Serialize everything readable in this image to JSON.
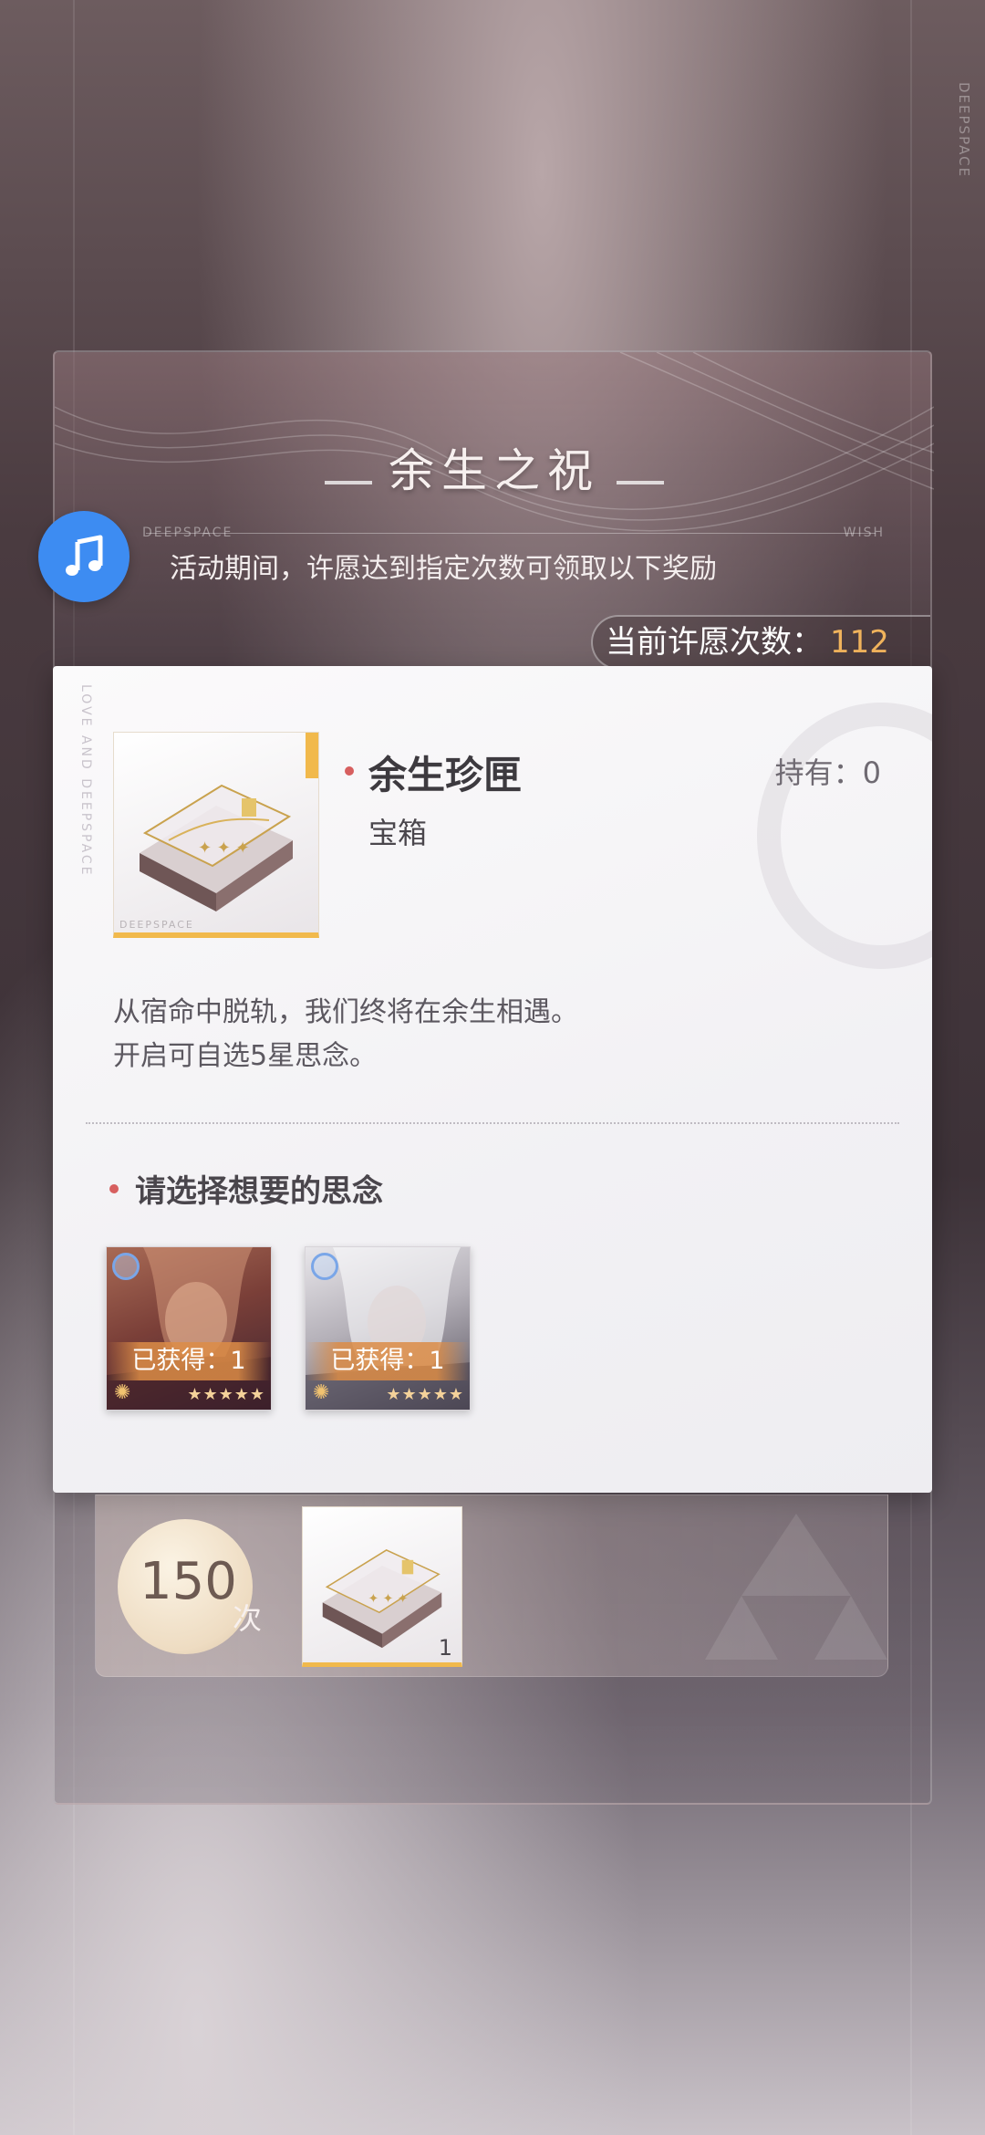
{
  "event": {
    "title": "余生之祝",
    "subtitle": "活动期间，许愿达到指定次数可领取以下奖励",
    "brand_left": "DEEPSPACE",
    "brand_right": "WISH",
    "side_text": "DEEPSPACE"
  },
  "wish_count": {
    "label": "当前许愿次数：",
    "value": "112"
  },
  "item": {
    "name": "余生珍匣",
    "type": "宝箱",
    "owned_label": "持有：0",
    "frame_brand": "DEEPSPACE",
    "card_vertical_text": "LOVE AND DEEPSPACE",
    "description": [
      "从宿命中脱轨，我们终将在余生相遇。",
      "开启可自选5星思念。"
    ]
  },
  "selection": {
    "title": "请选择想要的思念",
    "memories": [
      {
        "owned_label": "已获得：1",
        "stars": "★★★★★",
        "palette": "crimson"
      },
      {
        "owned_label": "已获得：1",
        "stars": "★★★★★",
        "palette": "silver"
      }
    ]
  },
  "milestone": {
    "count": "150",
    "unit": "次",
    "reward_qty": "1"
  },
  "icons": {
    "music": "music-note-icon",
    "reward_box": "treasure-box-icon"
  },
  "colors": {
    "accent_orange": "#f0b35c",
    "music_blue": "#3d8cf2",
    "bullet_red": "#d75f5f",
    "frame_gold": "#f1b94c"
  }
}
